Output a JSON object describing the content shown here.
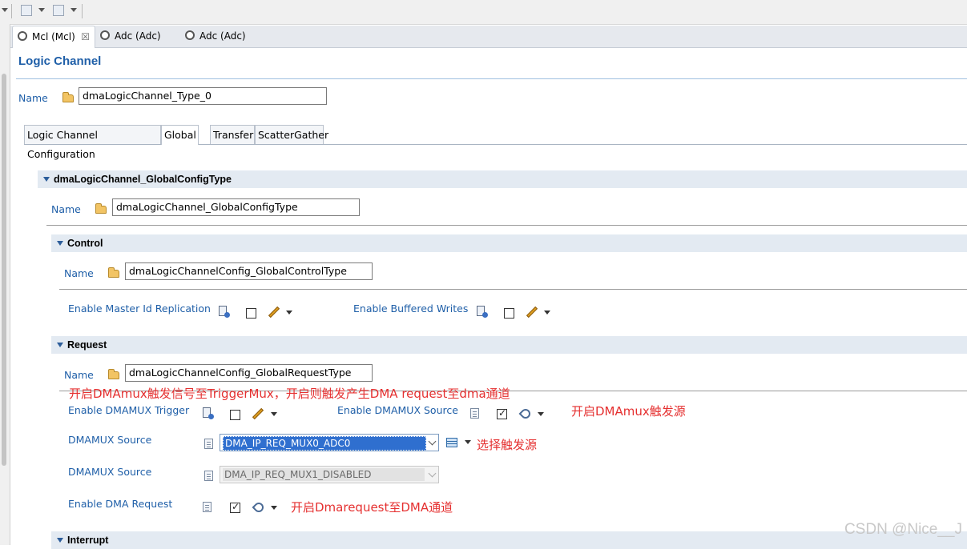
{
  "editor_tabs": [
    {
      "label": "Mcl (Mcl)",
      "close": "☒"
    },
    {
      "label": "Adc (Adc)"
    },
    {
      "label": "Adc (Adc)"
    }
  ],
  "page_title": "Logic Channel",
  "name_label": "Name",
  "name_value": "dmaLogicChannel_Type_0",
  "sub_tabs": [
    "Logic Channel Configuration",
    "Global",
    "Transfer",
    "ScatterGather"
  ],
  "global_section": {
    "title": "dmaLogicChannel_GlobalConfigType",
    "name_label": "Name",
    "name_value": "dmaLogicChannel_GlobalConfigType"
  },
  "control": {
    "title": "Control",
    "name_label": "Name",
    "name_value": "dmaLogicChannelConfig_GlobalControlType",
    "enable_master_id_label": "Enable Master Id Replication",
    "enable_buffered_writes_label": "Enable Buffered Writes"
  },
  "request": {
    "title": "Request",
    "name_label": "Name",
    "name_value": "dmaLogicChannelConfig_GlobalRequestType",
    "enable_dmamux_trigger_label": "Enable DMAMUX Trigger",
    "enable_dmamux_source_label": "Enable DMAMUX Source",
    "dmamux_source_label_1": "DMAMUX Source",
    "dmamux_source_value_1": "DMA_IP_REQ_MUX0_ADC0",
    "dmamux_source_label_2": "DMAMUX Source",
    "dmamux_source_value_2": "DMA_IP_REQ_MUX1_DISABLED",
    "enable_dma_request_label": "Enable DMA Request"
  },
  "interrupt": {
    "title": "Interrupt"
  },
  "annotations": {
    "trigger_note": "开启DMAmux触发信号至TriggerMux，开启则触发产生DMA request至dma通道",
    "source_note": "开启DMAmux触发源",
    "select_note": "选择触发源",
    "request_note": "开启Dmarequest至DMA通道"
  },
  "watermark": "CSDN @Nice__J",
  "colors": {
    "label_blue": "#1f5fa8",
    "annotation_red": "#e53030",
    "section_bg": "#e3eaf2"
  }
}
